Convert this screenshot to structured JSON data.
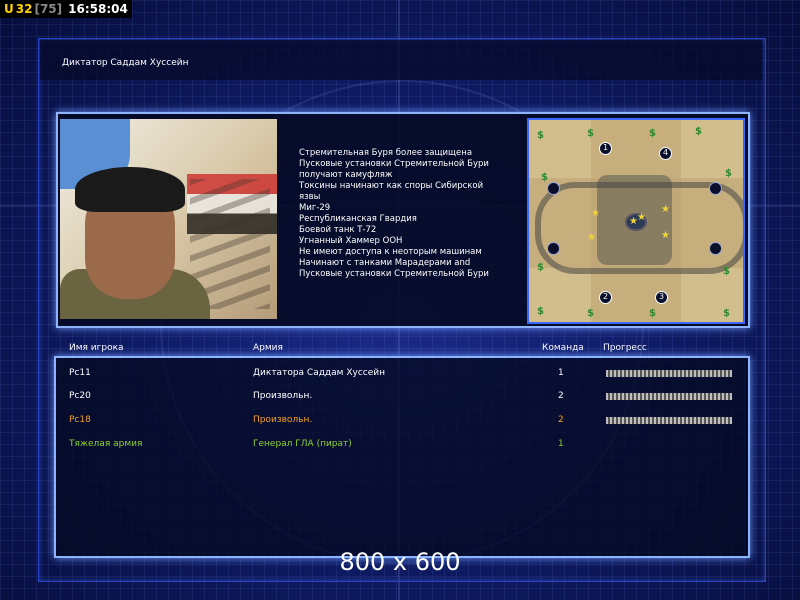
{
  "hud": {
    "unit_label": "U",
    "unit_count": "32",
    "unit_cap": "[75]",
    "clock": "16:58:04"
  },
  "title": "Диктатор Саддам Хуссейн",
  "description": [
    "Стремительная Буря более защищена",
    "Пусковые установки Стремительной Бури",
    " получают камуфляж",
    "Токсины начинают как споры Сибирской",
    " язвы",
    "Миг-29",
    "Республиканская Гвардия",
    "Боевой танк Т-72",
    "Угнанный Хаммер ООН",
    "Не имеют доступа к неоторым машинам",
    "Начинают с танками Марадерами and",
    " Пусковые установки Стремительной Бури"
  ],
  "minimap": {
    "start_labels": [
      "1",
      "4",
      "2",
      "3"
    ],
    "money_symbol": "$",
    "oil_symbol": "★"
  },
  "table": {
    "headers": {
      "player": "Имя игрока",
      "army": "Армия",
      "team": "Команда",
      "progress": "Прогресс"
    },
    "rows": [
      {
        "name": "Pc11",
        "army": "Диктатора Саддам Хуссейн",
        "team": "1",
        "color": "#ffffff",
        "progress": 1.0
      },
      {
        "name": "Pc20",
        "army": "Произвольн.",
        "team": "2",
        "color": "#ffffff",
        "progress": 1.0
      },
      {
        "name": "Pc18",
        "army": "Произвольн.",
        "team": "2",
        "color": "#f7a020",
        "progress": 1.0
      },
      {
        "name": "Тяжелая армия",
        "army": "Генерал ГЛА (пират)",
        "team": "1",
        "color": "#8fd22a",
        "progress": null
      }
    ]
  },
  "resolution": "800 x 600"
}
